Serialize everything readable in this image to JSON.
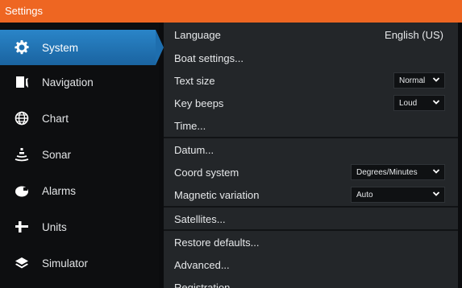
{
  "window": {
    "title": "Settings"
  },
  "sidebar": {
    "items": [
      {
        "label": "System",
        "icon": "gear-icon",
        "active": true
      },
      {
        "label": "Navigation",
        "icon": "navigation-icon"
      },
      {
        "label": "Chart",
        "icon": "globe-icon"
      },
      {
        "label": "Sonar",
        "icon": "sonar-icon"
      },
      {
        "label": "Alarms",
        "icon": "alarm-icon"
      },
      {
        "label": "Units",
        "icon": "units-icon"
      },
      {
        "label": "Simulator",
        "icon": "layers-icon"
      }
    ]
  },
  "settings": {
    "language": {
      "label": "Language",
      "value": "English (US)"
    },
    "boat_settings": {
      "label": "Boat settings..."
    },
    "text_size": {
      "label": "Text size",
      "value": "Normal"
    },
    "key_beeps": {
      "label": "Key beeps",
      "value": "Loud"
    },
    "time": {
      "label": "Time..."
    },
    "datum": {
      "label": "Datum..."
    },
    "coord_system": {
      "label": "Coord system",
      "value": "Degrees/Minutes"
    },
    "magnetic_variation": {
      "label": "Magnetic variation",
      "value": "Auto"
    },
    "satellites": {
      "label": "Satellites..."
    },
    "restore_defaults": {
      "label": "Restore defaults..."
    },
    "advanced": {
      "label": "Advanced..."
    },
    "registration": {
      "label": "Registration..."
    }
  },
  "colors": {
    "title_bar": "#ee6622",
    "active_item": "#1e6eae",
    "panel_bg": "#232629",
    "sidebar_bg": "#0d0e10"
  }
}
